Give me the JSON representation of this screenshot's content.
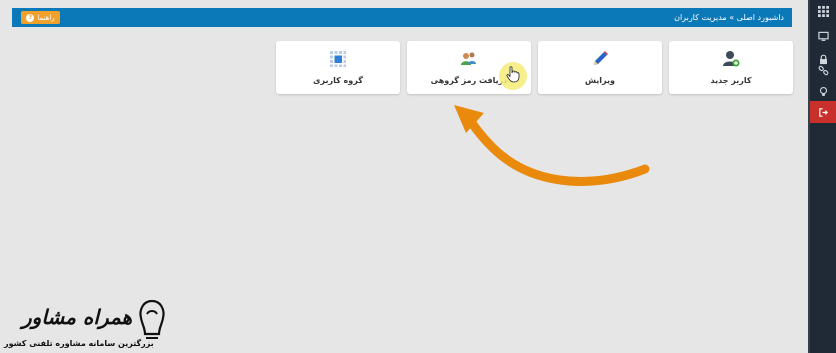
{
  "colors": {
    "background": "#e6e6e6",
    "topbar": "#0b78b8",
    "sidebar": "#1f2a36",
    "sidebar_active": "#c8302c",
    "help_button": "#f0a12c",
    "arrow": "#e98a0c"
  },
  "topbar": {
    "breadcrumb": "داشبورد اصلی » مدیریت کاربران",
    "help_label": "راهنما"
  },
  "sidebar": {
    "items": [
      {
        "icon": "grid-icon"
      },
      {
        "icon": "monitor-icon"
      },
      {
        "icon": "lock-icon"
      },
      {
        "icon": "link-icon"
      },
      {
        "icon": "lightbulb-icon"
      },
      {
        "icon": "logout-icon",
        "active": true
      }
    ]
  },
  "cards": [
    {
      "label": "کاربر جدید",
      "icon": "add-user-icon"
    },
    {
      "label": "ویرایش",
      "icon": "pencil-icon"
    },
    {
      "label": "دریافت رمز گروهی",
      "icon": "group-password-icon"
    },
    {
      "label": "گروه کاربری",
      "icon": "user-group-grid-icon"
    }
  ],
  "watermark": {
    "title": "همراه مشاور",
    "subtitle": "بزرگترین سامانه مشاوره تلفنی کشور"
  }
}
